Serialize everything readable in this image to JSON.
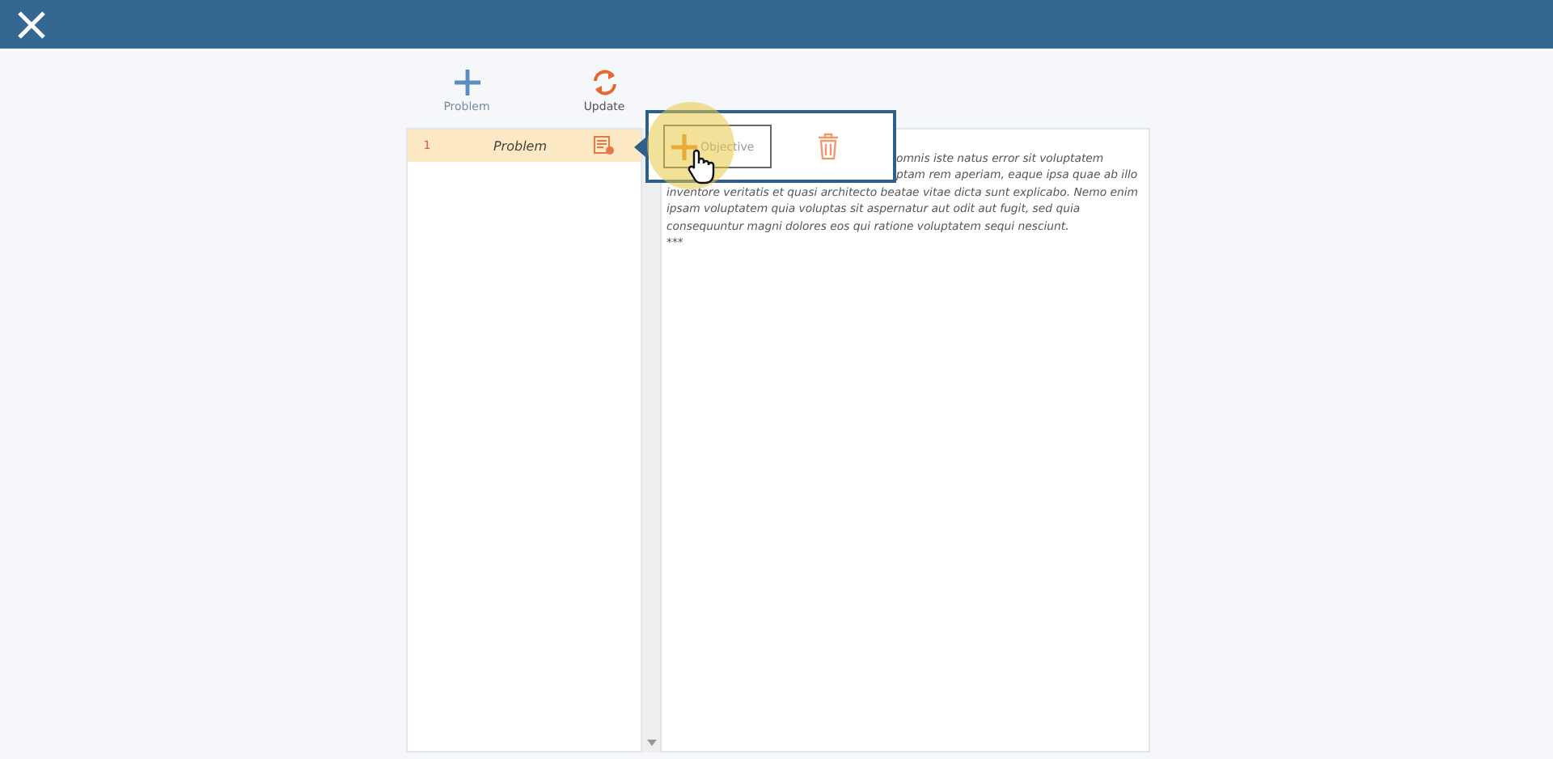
{
  "toolbar": [
    {
      "label": "Problem",
      "kind": "add"
    },
    {
      "label": "Update",
      "kind": "refresh"
    }
  ],
  "items": [
    {
      "number": "1",
      "label": "Problem",
      "selected": true
    }
  ],
  "popup": {
    "button": "Objective"
  },
  "text": {
    "partly_covered_lines": [
      "omnis iste natus error sit voluptatem",
      "ptam rem aperiam, eaque ipsa quae ab illo"
    ],
    "lines": [
      "inventore veritatis et quasi architecto beatae vitae dicta sunt explicabo. Nemo enim",
      "ipsam voluptatem quia voluptas sit aspernatur aut odit aut fugit, sed quia",
      "consequuntur magni dolores eos qui ratione voluptatem sequi nesciunt.",
      "***"
    ]
  }
}
